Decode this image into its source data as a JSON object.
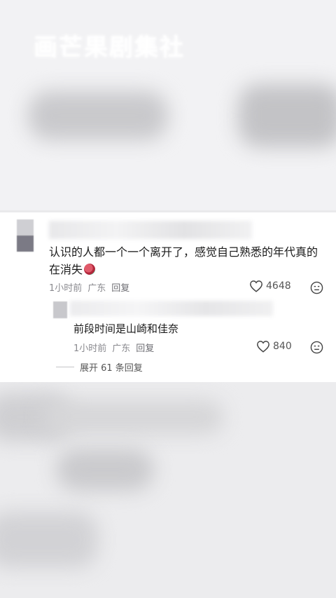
{
  "watermark": "画芒果剧集社",
  "comment": {
    "text": "认识的人都一个一个离开了，感觉自己熟悉的年代真的在消失",
    "emoji_icon": "heart-emoji-icon",
    "time": "1小时前",
    "location": "广东",
    "reply_label": "回复",
    "likes": "4648"
  },
  "reply": {
    "text": "前段时间是山崎和佳奈",
    "time": "1小时前",
    "location": "广东",
    "reply_label": "回复",
    "likes": "840"
  },
  "expand_label": "展开 61 条回复"
}
